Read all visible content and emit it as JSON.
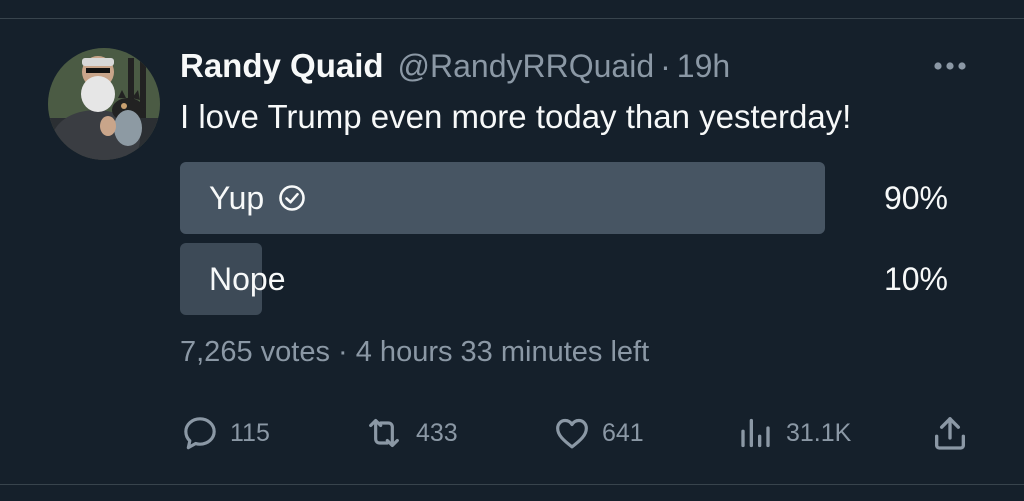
{
  "tweet": {
    "author": {
      "display_name": "Randy Quaid",
      "handle": "@RandyRRQuaid",
      "separator": "·",
      "time": "19h"
    },
    "text": "I love Trump even more today than yesterday!",
    "poll": {
      "options": [
        {
          "label": "Yup",
          "percent_text": "90%",
          "percent": 90,
          "selected": true
        },
        {
          "label": "Nope",
          "percent_text": "10%",
          "percent": 10,
          "selected": false
        }
      ],
      "votes_text": "7,265 votes",
      "separator": "·",
      "time_left": "4 hours 33 minutes left"
    },
    "actions": {
      "replies": "115",
      "reposts": "433",
      "likes": "641",
      "views": "31.1K"
    }
  },
  "icons": {
    "more": "more-dots-icon",
    "check": "check-circle-icon",
    "reply": "reply-icon",
    "repost": "repost-icon",
    "like": "heart-icon",
    "views": "views-chart-icon",
    "share": "share-icon"
  },
  "colors": {
    "background": "#15202b",
    "text_primary": "#f7f9f9",
    "text_secondary": "#8b98a5",
    "poll_fill_winner": "#475563",
    "poll_fill_other": "#3d4a57"
  }
}
